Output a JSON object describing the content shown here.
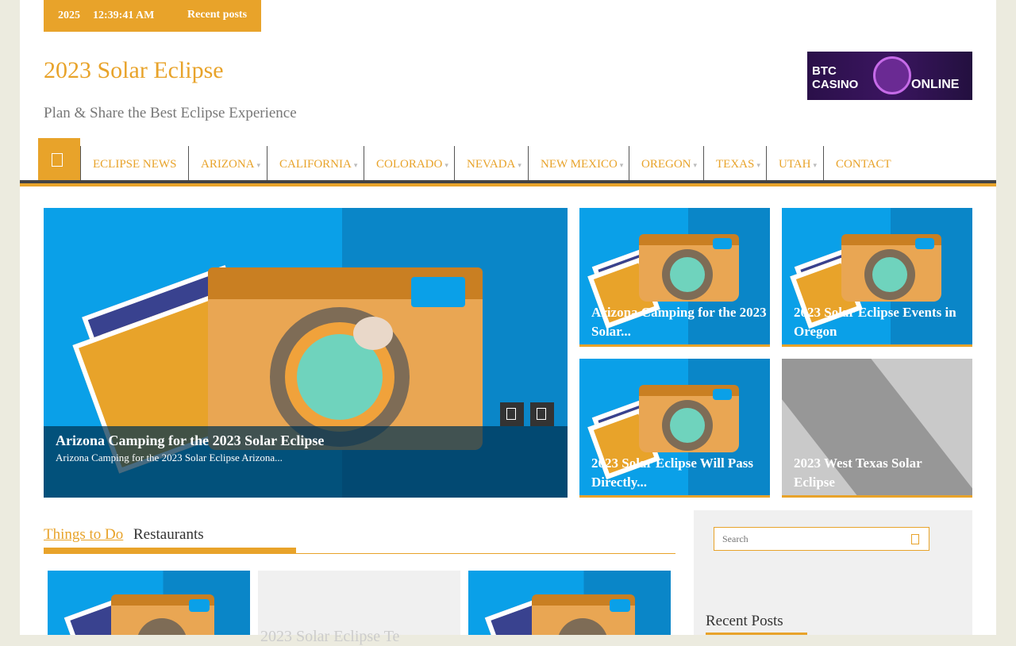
{
  "topbar": {
    "year": "2025",
    "time": "12:39:41 AM",
    "recent_label": "Recent posts"
  },
  "header": {
    "site_title": "2023 Solar Eclipse",
    "tagline": "Plan & Share the Best Eclipse Experience",
    "ad": {
      "line1": "BTC",
      "line2": "CASINO",
      "line3": "ONLINE"
    }
  },
  "nav": {
    "home_icon": "home-icon",
    "items": [
      {
        "label": "ECLIPSE NEWS",
        "has_sub": false
      },
      {
        "label": "ARIZONA",
        "has_sub": true
      },
      {
        "label": "CALIFORNIA",
        "has_sub": true
      },
      {
        "label": "COLORADO",
        "has_sub": true
      },
      {
        "label": "NEVADA",
        "has_sub": true
      },
      {
        "label": "NEW MEXICO",
        "has_sub": true
      },
      {
        "label": "OREGON",
        "has_sub": true
      },
      {
        "label": "TEXAS",
        "has_sub": true
      },
      {
        "label": "UTAH",
        "has_sub": true
      },
      {
        "label": "CONTACT",
        "has_sub": false
      }
    ]
  },
  "hero": {
    "title": "Arizona Camping for the 2023 Solar Eclipse",
    "excerpt": "Arizona Camping for the 2023 Solar Eclipse   Arizona..."
  },
  "tiles": [
    {
      "title": "Arizona Camping for the 2023 Solar..."
    },
    {
      "title": "2023 Solar Eclipse Events in Oregon"
    },
    {
      "title": "2023 Solar Eclipse Will Pass Directly..."
    },
    {
      "title": "2023 West Texas Solar Eclipse"
    }
  ],
  "tabs": {
    "active": "Things to Do",
    "inactive": "Restaurants"
  },
  "cards": [
    {
      "title": ""
    },
    {
      "title": "2023 Solar Eclipse Te"
    },
    {
      "title": ""
    }
  ],
  "sidebar": {
    "search_placeholder": "Search",
    "recent_heading": "Recent Posts"
  },
  "colors": {
    "accent": "#e8a32a",
    "dark": "#444444"
  }
}
